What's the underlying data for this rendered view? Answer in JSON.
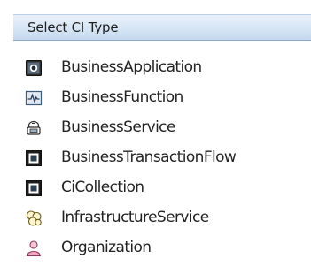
{
  "header": {
    "title": "Select CI Type"
  },
  "ci_types": [
    {
      "label": "BusinessApplication",
      "icon": "business-application-icon"
    },
    {
      "label": "BusinessFunction",
      "icon": "business-function-icon"
    },
    {
      "label": "BusinessService",
      "icon": "business-service-icon"
    },
    {
      "label": "BusinessTransactionFlow",
      "icon": "business-transaction-flow-icon"
    },
    {
      "label": "CiCollection",
      "icon": "ci-collection-icon"
    },
    {
      "label": "InfrastructureService",
      "icon": "infrastructure-service-icon"
    },
    {
      "label": "Organization",
      "icon": "organization-icon"
    }
  ],
  "colors": {
    "header_gradient_top": "#e9f1fa",
    "header_gradient_bottom": "#c5d8ee",
    "text": "#222222"
  }
}
